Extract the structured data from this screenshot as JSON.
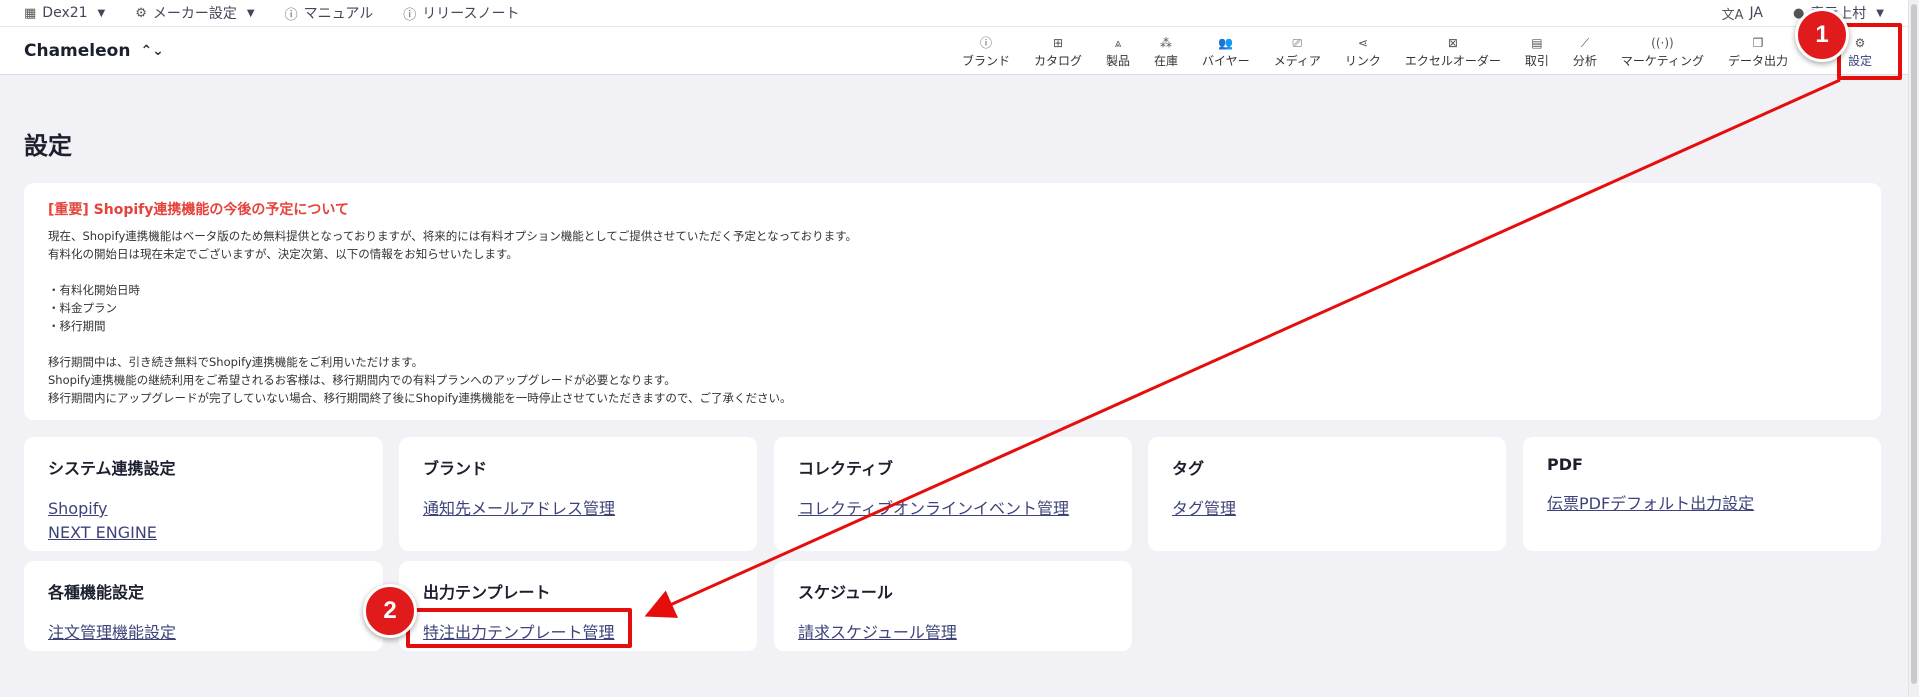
{
  "topbar": {
    "org": "Dex21",
    "maker_settings": "メーカー設定",
    "manual": "マニュアル",
    "release_notes": "リリースノート",
    "language": "JA",
    "user": "表示上村"
  },
  "header": {
    "app_name": "Chameleon",
    "nav": [
      {
        "label": "ブランド",
        "icon": "info-icon",
        "glyph": "ⓘ"
      },
      {
        "label": "カタログ",
        "icon": "grid-icon",
        "glyph": "⊞"
      },
      {
        "label": "製品",
        "icon": "hanger-icon",
        "glyph": "⩓"
      },
      {
        "label": "在庫",
        "icon": "boxes-icon",
        "glyph": "⁂"
      },
      {
        "label": "バイヤー",
        "icon": "people-icon",
        "glyph": "👥"
      },
      {
        "label": "メディア",
        "icon": "cast-icon",
        "glyph": "⎚"
      },
      {
        "label": "リンク",
        "icon": "share-icon",
        "glyph": "⋖"
      },
      {
        "label": "エクセルオーダー",
        "icon": "excel-icon",
        "glyph": "⊠"
      },
      {
        "label": "取引",
        "icon": "receipt-icon",
        "glyph": "▤"
      },
      {
        "label": "分析",
        "icon": "chart-icon",
        "glyph": "⟋"
      },
      {
        "label": "マーケティング",
        "icon": "broadcast-icon",
        "glyph": "((·))"
      },
      {
        "label": "データ出力",
        "icon": "copy-icon",
        "glyph": "❐"
      },
      {
        "label": "",
        "icon": "hidden-icon",
        "glyph": "⋯"
      },
      {
        "label": "設定",
        "icon": "gear-icon",
        "glyph": "⚙"
      }
    ]
  },
  "page": {
    "title": "設定"
  },
  "notice": {
    "title": "[重要] Shopify連携機能の今後の予定について",
    "lines": [
      "現在、Shopify連携機能はベータ版のため無料提供となっておりますが、将来的には有料オプション機能としてご提供させていただく予定となっております。",
      "有料化の開始日は現在未定でございますが、決定次第、以下の情報をお知らせいたします。",
      "",
      "・有料化開始日時",
      "・料金プラン",
      "・移行期間",
      "",
      "移行期間中は、引き続き無料でShopify連携機能をご利用いただけます。",
      "Shopify連携機能の継続利用をご希望されるお客様は、移行期間内での有料プランへのアップグレードが必要となります。",
      "移行期間内にアップグレードが完了していない場合、移行期間終了後にShopify連携機能を一時停止させていただきますので、ご了承ください。"
    ]
  },
  "cards": {
    "system": {
      "title": "システム連携設定",
      "links": [
        "Shopify",
        "NEXT ENGINE"
      ]
    },
    "brand": {
      "title": "ブランド",
      "links": [
        "通知先メールアドレス管理"
      ]
    },
    "collective": {
      "title": "コレクティブ",
      "links": [
        "コレクティブオンラインイベント管理"
      ]
    },
    "tag": {
      "title": "タグ",
      "links": [
        "タグ管理"
      ]
    },
    "pdf": {
      "title": "PDF",
      "links": [
        "伝票PDFデフォルト出力設定"
      ]
    },
    "features": {
      "title": "各種機能設定",
      "links": [
        "注文管理機能設定"
      ]
    },
    "output": {
      "title": "出力テンプレート",
      "links": [
        "特注出力テンプレート管理"
      ]
    },
    "schedule": {
      "title": "スケジュール",
      "links": [
        "請求スケジュール管理"
      ]
    }
  },
  "annotations": {
    "badge1": "1",
    "badge2": "2",
    "color": "#e60d0d"
  }
}
